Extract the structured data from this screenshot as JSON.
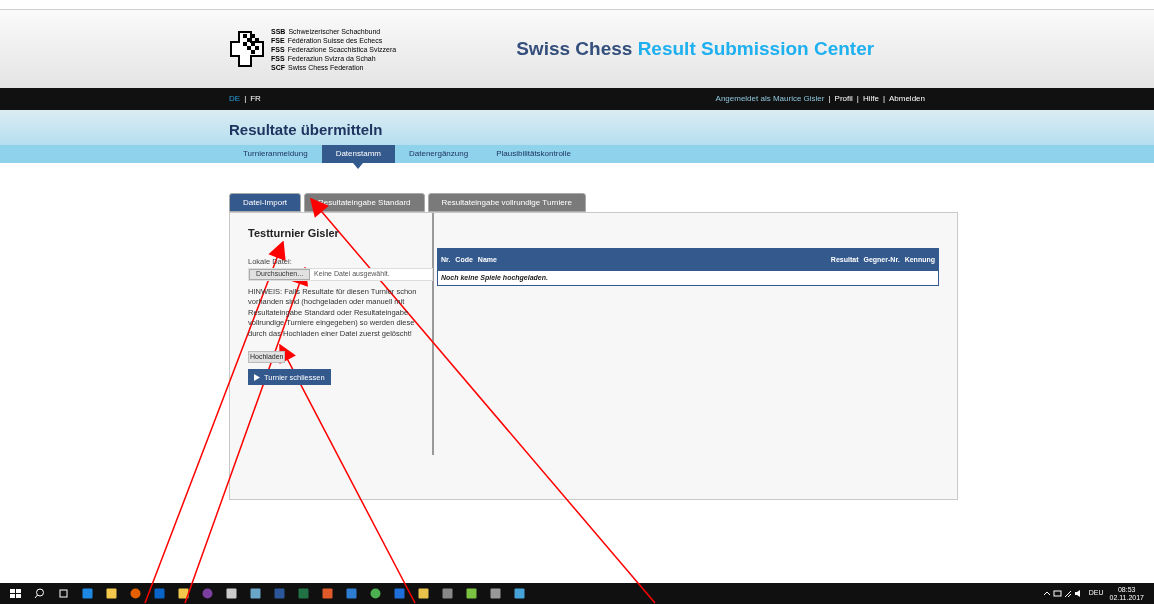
{
  "logo": {
    "lines": [
      {
        "abbr": "SSB",
        "name": "Schweizerischer Schachbund"
      },
      {
        "abbr": "FSE",
        "name": "Fédération Suisse des Echecs"
      },
      {
        "abbr": "FSS",
        "name": "Federazione Scacchistica Svizzera"
      },
      {
        "abbr": "FSS",
        "name": "Federaziun Svizra da Schah"
      },
      {
        "abbr": "SCF",
        "name": "Swiss Chess Federation"
      }
    ]
  },
  "site_title": {
    "part_1": "Swiss Chess",
    "part_2": "Result Submission Center"
  },
  "languages": {
    "separator": "|",
    "items": [
      {
        "label": "DE",
        "selected": true
      },
      {
        "label": "FR",
        "selected": false
      }
    ]
  },
  "user_nav": [
    {
      "kind": "status",
      "text": "Angemeldet als Maurice Gisler"
    },
    {
      "kind": "separator",
      "text": "|"
    },
    {
      "kind": "link",
      "text": "Profil"
    },
    {
      "kind": "separator",
      "text": "|"
    },
    {
      "kind": "link",
      "text": "Hilfe"
    },
    {
      "kind": "separator",
      "text": "|"
    },
    {
      "kind": "link",
      "text": "Abmelden"
    }
  ],
  "page_title": "Resultate übermitteln",
  "steps": [
    {
      "label": "Turnieranmeldung",
      "selected": false
    },
    {
      "label": "Datenstamm",
      "selected": true
    },
    {
      "label": "Datenergänzung",
      "selected": false
    },
    {
      "label": "Plausibilitätskontrolle",
      "selected": false
    }
  ],
  "tabs": [
    {
      "label": "Datei-Import",
      "selected": true
    },
    {
      "label": "Resultateingabe Standard",
      "selected": false
    },
    {
      "label": "Resultateingabe vollrundige Turniere",
      "selected": false
    }
  ],
  "tournament": "Testturnier Gisler",
  "file_field": {
    "label": "Lokale Datei:",
    "button": "Durchsuchen...",
    "value": "Keine Datei ausgewählt."
  },
  "notice": "HINWEIS: Falls Resultate für diesen Turnier schon vorhanden sind (hochgeladen oder manuell mit Resultateingabe Standard oder Resultateingabe vollrundige Turniere eingegeben) so werden diese durch das Hochladen einer Datei zuerst gelöscht!",
  "upload_button": "Hochladen",
  "close_button": "Turnier schliessen",
  "table": {
    "columns_left": [
      "Nr.",
      "Code",
      "Name"
    ],
    "columns_right": [
      "Resultat",
      "Gegner-Nr.",
      "Kennung"
    ],
    "empty_message": "Noch keine Spiele hochgeladen."
  },
  "taskbar": {
    "language": "DEU",
    "time": "08:53",
    "date": "02.11.2017"
  }
}
